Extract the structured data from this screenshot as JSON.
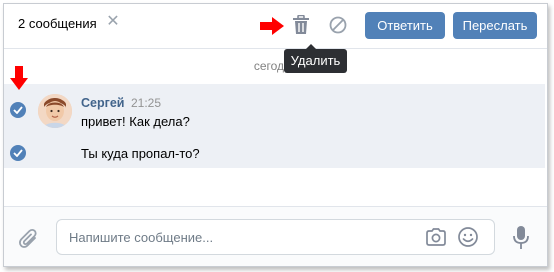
{
  "header": {
    "selected_count": "2 сообщения",
    "close_symbol": "✕",
    "reply_label": "Ответить",
    "forward_label": "Переслать"
  },
  "tooltip": {
    "delete_label": "Удалить"
  },
  "date_separator": "сегодня",
  "message_group": {
    "author": "Сергей",
    "time": "21:25",
    "messages": [
      {
        "text": "привет! Как дела?"
      },
      {
        "text": "Ты куда пропал-то?"
      }
    ]
  },
  "composer": {
    "placeholder": "Напишите сообщение..."
  },
  "colors": {
    "accent": "#5181b8",
    "selected_bg": "#edf0f5",
    "annotation_red": "#ff0000",
    "author_link": "#42648b"
  },
  "icons": [
    "close-icon",
    "trash-icon",
    "block-icon",
    "check-icon",
    "paperclip-icon",
    "camera-icon",
    "smile-icon",
    "microphone-icon",
    "red-arrow-right-icon",
    "red-arrow-down-icon"
  ]
}
